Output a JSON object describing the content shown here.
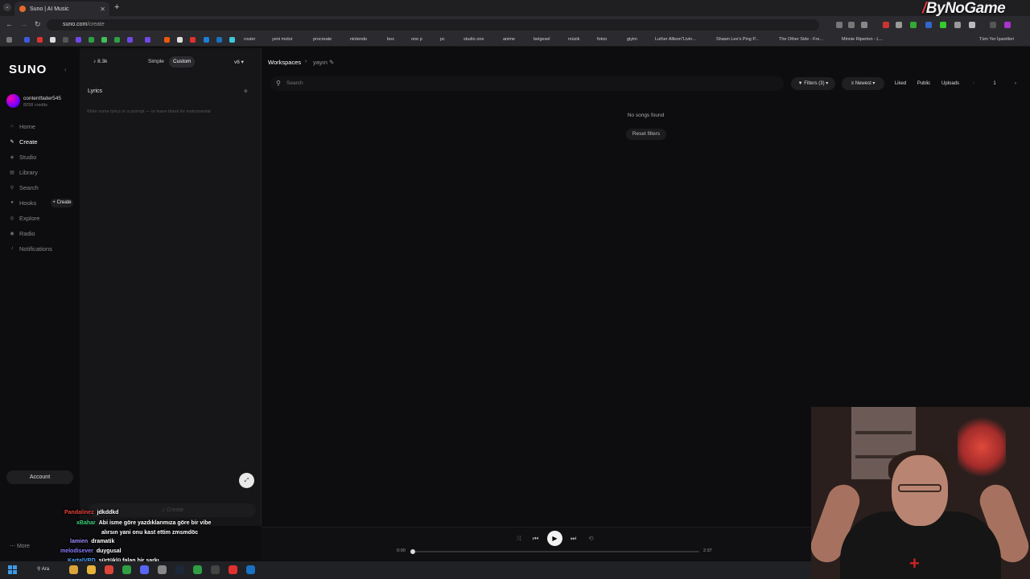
{
  "browser": {
    "tab_title": "Suno | AI Music",
    "new_tab": "+",
    "url_host": "suno.com",
    "url_path": "/create",
    "brand_overlay": "ByNoGame",
    "bookmarks": [
      "router",
      "yeni motor",
      "procreate",
      "nintendo",
      "box",
      "one p",
      "pc",
      "studio one",
      "anime",
      "belgesel",
      "müzik",
      "fotoo",
      "giyim",
      "Luther Allison\"Livin...",
      "Shawn Lee's Ping P...",
      "The Other Side - Fre...",
      "Minnie Riperton - L...",
      "Tüm Yer İşaretleri"
    ]
  },
  "sidebar": {
    "logo": "SUNO",
    "username": "contentfader545",
    "credits": "8258 credits",
    "items": [
      {
        "label": "Home",
        "icon": "home-icon"
      },
      {
        "label": "Create",
        "icon": "create-icon",
        "active": true
      },
      {
        "label": "Studio",
        "icon": "studio-icon"
      },
      {
        "label": "Library",
        "icon": "library-icon"
      },
      {
        "label": "Search",
        "icon": "search-icon"
      },
      {
        "label": "Hooks",
        "icon": "hooks-icon"
      },
      {
        "label": "Explore",
        "icon": "explore-icon"
      },
      {
        "label": "Radio",
        "icon": "radio-icon"
      },
      {
        "label": "Notifications",
        "icon": "bell-icon"
      }
    ],
    "hooks_create": "+ Create",
    "account": "Account",
    "more": "More"
  },
  "create_panel": {
    "credits": "8.3k",
    "mode_simple": "Simple",
    "mode_custom": "Custom",
    "version": "v6",
    "lyrics_label": "Lyrics",
    "lyrics_placeholder": "Write some lyrics or a prompt — or leave blank for instrumental",
    "create_button": "Create"
  },
  "main": {
    "breadcrumb_root": "Workspaces",
    "breadcrumb_current": "yayın",
    "search_placeholder": "Search",
    "filters": "Filters (3)",
    "sort": "Newest",
    "liked": "Liked",
    "public": "Public",
    "uploads": "Uploads",
    "page": "1",
    "empty_message": "No songs found",
    "reset_filters": "Reset filters"
  },
  "player": {
    "time_current": "0:00",
    "time_total": "2:37",
    "progress": 0
  },
  "chat": [
    {
      "user": "Pandalinez",
      "message": "jdkddkd",
      "color": "#e8413a"
    },
    {
      "user": "xBahar",
      "message": "Abi isme göre yazdıklarımıza göre bir vibe",
      "color": "#39d47a"
    },
    {
      "user": "",
      "message": "alırsın yani onu kast ettim zmsmdöc",
      "color": "#ffffff"
    },
    {
      "user": "lamien",
      "message": "dramatik",
      "color": "#9b8cff"
    },
    {
      "user": "melodisever",
      "message": "duygusal",
      "color": "#8a7dff"
    },
    {
      "user": "KartalVRD",
      "message": "sürtüklü falan bir şarkı",
      "color": "#4aa3ff"
    }
  ],
  "taskbar": {
    "search_label": "Ara"
  }
}
